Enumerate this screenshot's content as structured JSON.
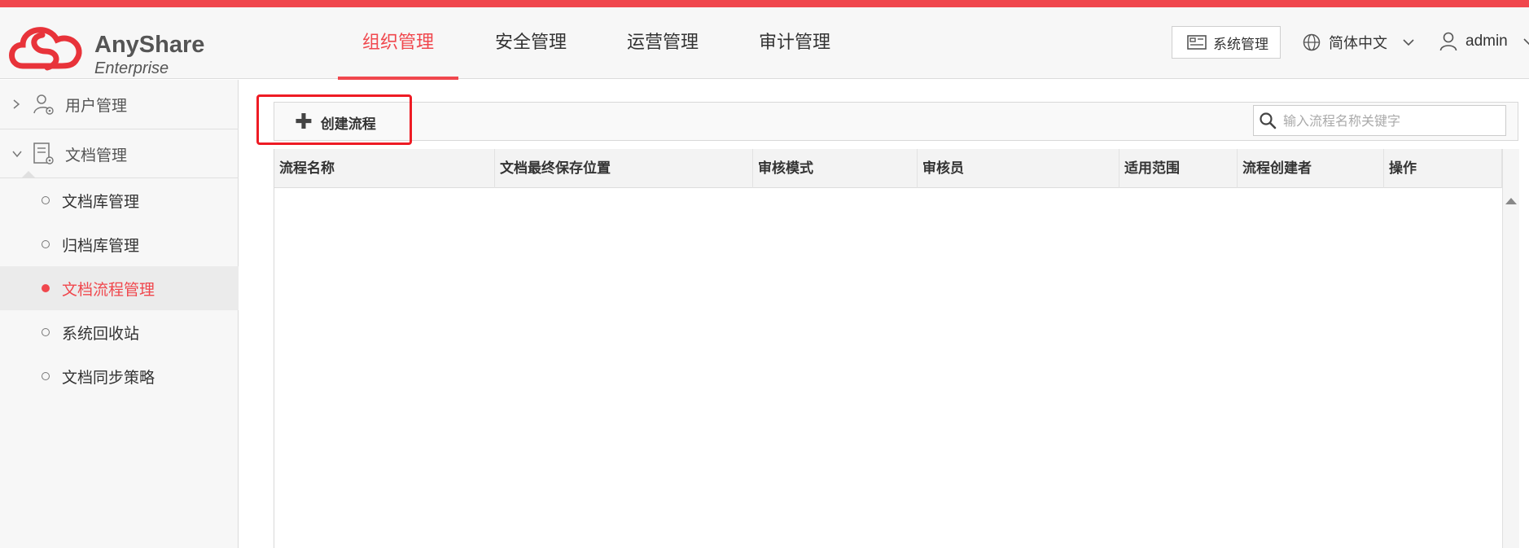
{
  "brand": {
    "name": "AnyShare",
    "edition": "Enterprise",
    "accent": "#f0474d"
  },
  "nav": {
    "tabs": [
      {
        "label": "组织管理",
        "active": true
      },
      {
        "label": "安全管理",
        "active": false
      },
      {
        "label": "运营管理",
        "active": false
      },
      {
        "label": "审计管理",
        "active": false
      }
    ]
  },
  "header_right": {
    "system_label": "系统管理",
    "language_label": "简体中文",
    "user_label": "admin"
  },
  "sidebar": {
    "groups": [
      {
        "label": "用户管理",
        "expanded": false,
        "icon": "user-gear-icon"
      },
      {
        "label": "文档管理",
        "expanded": true,
        "icon": "document-gear-icon"
      }
    ],
    "items": [
      {
        "label": "文档库管理",
        "active": false
      },
      {
        "label": "归档库管理",
        "active": false
      },
      {
        "label": "文档流程管理",
        "active": true
      },
      {
        "label": "系统回收站",
        "active": false
      },
      {
        "label": "文档同步策略",
        "active": false
      }
    ]
  },
  "toolbar": {
    "create_label": "创建流程",
    "search_placeholder": "输入流程名称关键字"
  },
  "table": {
    "columns": [
      "流程名称",
      "文档最终保存位置",
      "审核模式",
      "审核员",
      "适用范围",
      "流程创建者",
      "操作"
    ],
    "rows": []
  }
}
